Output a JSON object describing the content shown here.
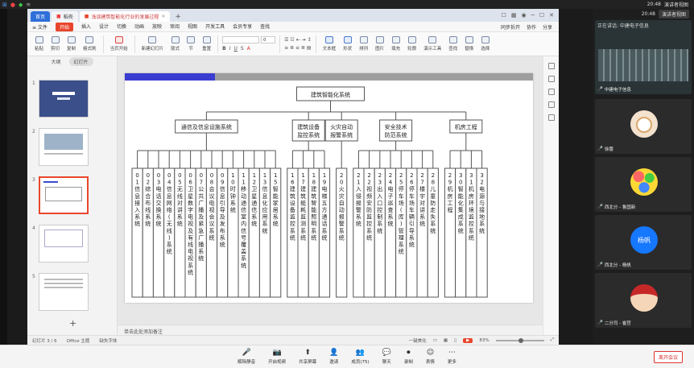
{
  "win_controls": [
    "─",
    "☐"
  ],
  "top_right": {
    "time": "20:48",
    "view_label": "演讲者视图"
  },
  "tabs": [
    {
      "label": "首页",
      "kind": "home"
    },
    {
      "label": "稻壳",
      "kind": "doc"
    },
    {
      "label": "浅谈建筑智能化行业的发展过程",
      "kind": "active"
    }
  ],
  "tab_right": [
    "☐",
    "▦",
    "◉",
    "─",
    "☐",
    "✕"
  ],
  "menu": {
    "file": "≡ 文件",
    "items": [
      "开始",
      "插入",
      "设计",
      "切换",
      "动画",
      "放映",
      "审阅",
      "视图",
      "开发工具",
      "会员专享",
      "查找"
    ],
    "active": "开始",
    "right": [
      "同步拆开",
      "协作",
      "分享"
    ]
  },
  "ribbon": {
    "buttons": [
      "粘贴",
      "剪切",
      "复制",
      "格式刷",
      "当页开始",
      "新建幻灯片",
      "版式",
      "节",
      "重置"
    ],
    "font_value": "",
    "size_value": "0",
    "right_buttons": [
      "文本框",
      "形状",
      "排列",
      "图片",
      "填充",
      "轮廓",
      "演示工具",
      "查找",
      "替换",
      "选择"
    ]
  },
  "panel": {
    "tab_outline": "大纲",
    "tab_slides": "幻灯片"
  },
  "slides": [
    {
      "num": "1"
    },
    {
      "num": "2"
    },
    {
      "num": "3"
    },
    {
      "num": "4"
    },
    {
      "num": "5"
    }
  ],
  "notes_placeholder": "单击此处添加备注",
  "status": {
    "slide_count": "幻灯片 3 / 6",
    "theme": "Office 主题",
    "font_missing": "缺失字体",
    "smart": "一键美化",
    "zoom": "83%"
  },
  "chart_data": {
    "type": "table",
    "root": "建筑智能化系统",
    "groups": [
      {
        "name": "通信及信息设施系统",
        "items": [
          {
            "no": "01",
            "text": "信息接入系统"
          },
          {
            "no": "02",
            "text": "综合布线系统"
          },
          {
            "no": "03",
            "text": "电话交换系统"
          },
          {
            "no": "04",
            "text": "信息网络(无线)系统"
          },
          {
            "no": "05",
            "text": "无线对讲系统"
          },
          {
            "no": "06",
            "text": "卫星数字电视及有线电视系统"
          },
          {
            "no": "07",
            "text": "公共广播及紧急广播系统"
          },
          {
            "no": "08",
            "text": "会议电视会议系统"
          },
          {
            "no": "09",
            "text": "信息引导及发布系统"
          },
          {
            "no": "10",
            "text": "时钟系统"
          },
          {
            "no": "11",
            "text": "移动通信室内信号覆盖系统"
          },
          {
            "no": "12",
            "text": "卫星通信系统"
          },
          {
            "no": "13",
            "text": "信息化应用系统"
          },
          {
            "no": "15",
            "text": "智能家居系统"
          }
        ]
      },
      {
        "name": "建筑设备监控系统",
        "items": [
          {
            "no": "16",
            "text": "建筑设备监控系统"
          },
          {
            "no": "17",
            "text": "建筑能耗监测系统"
          },
          {
            "no": "18",
            "text": "建筑智能照明系统"
          },
          {
            "no": "19",
            "text": "电梯五方通话系统"
          }
        ]
      },
      {
        "name": "火灾自动报警系统",
        "items": [
          {
            "no": "20",
            "text": "火灾自动报警系统"
          }
        ]
      },
      {
        "name": "安全技术防范系统",
        "items": [
          {
            "no": "21",
            "text": "入侵报警系统"
          },
          {
            "no": "22",
            "text": "视频安防监控系统"
          },
          {
            "no": "23",
            "text": "出入口控制系统"
          },
          {
            "no": "24",
            "text": "电子巡查系统"
          },
          {
            "no": "25",
            "text": "停车场(库)管理系统"
          },
          {
            "no": "26",
            "text": "停车场车辆引导系统"
          },
          {
            "no": "27",
            "text": "楼宇对讲系统"
          },
          {
            "no": "28",
            "text": "儿童防走失系统"
          }
        ]
      },
      {
        "name": "机房工程",
        "items": [
          {
            "no": "29",
            "text": "机房工程"
          },
          {
            "no": "30",
            "text": "智能化集成系统"
          },
          {
            "no": "31",
            "text": "机房环境监控系统"
          },
          {
            "no": "32",
            "text": "电源与接地系统"
          }
        ]
      }
    ]
  },
  "meeting": {
    "speaking": "正在讲话: 中建电子信息",
    "tiles": [
      {
        "name": "中建电子信息",
        "kind": "screen"
      },
      {
        "name": "徐蕾",
        "kind": "dog"
      },
      {
        "name": "西北分 - 鲁国新",
        "kind": "balloons"
      },
      {
        "name": "西北分 - 杨帆",
        "kind": "initials",
        "initials": "杨帆"
      },
      {
        "name": "二分司 - 崔哲",
        "kind": "mario"
      }
    ],
    "colors": {
      "accent_blue": "#1677ff",
      "end_red": "#d33333"
    }
  },
  "bottom_bar": {
    "buttons": [
      {
        "label": "解除静音",
        "icon": "mic-icon",
        "glyph": "🎤"
      },
      {
        "label": "开启视频",
        "icon": "camera-icon",
        "glyph": "📷"
      },
      {
        "label": "共享屏幕",
        "icon": "share-screen-icon",
        "glyph": "⬆"
      },
      {
        "label": "邀请",
        "icon": "invite-icon",
        "glyph": "👤"
      },
      {
        "label": "成员(75)",
        "icon": "members-icon",
        "glyph": "👥"
      },
      {
        "label": "聊天",
        "icon": "chat-icon",
        "glyph": "💬"
      },
      {
        "label": "录制",
        "icon": "record-icon",
        "glyph": "⏺"
      },
      {
        "label": "表情",
        "icon": "emoji-icon",
        "glyph": "☺"
      },
      {
        "label": "更多",
        "icon": "more-icon",
        "glyph": "⋯"
      }
    ],
    "end": "离开会议"
  }
}
